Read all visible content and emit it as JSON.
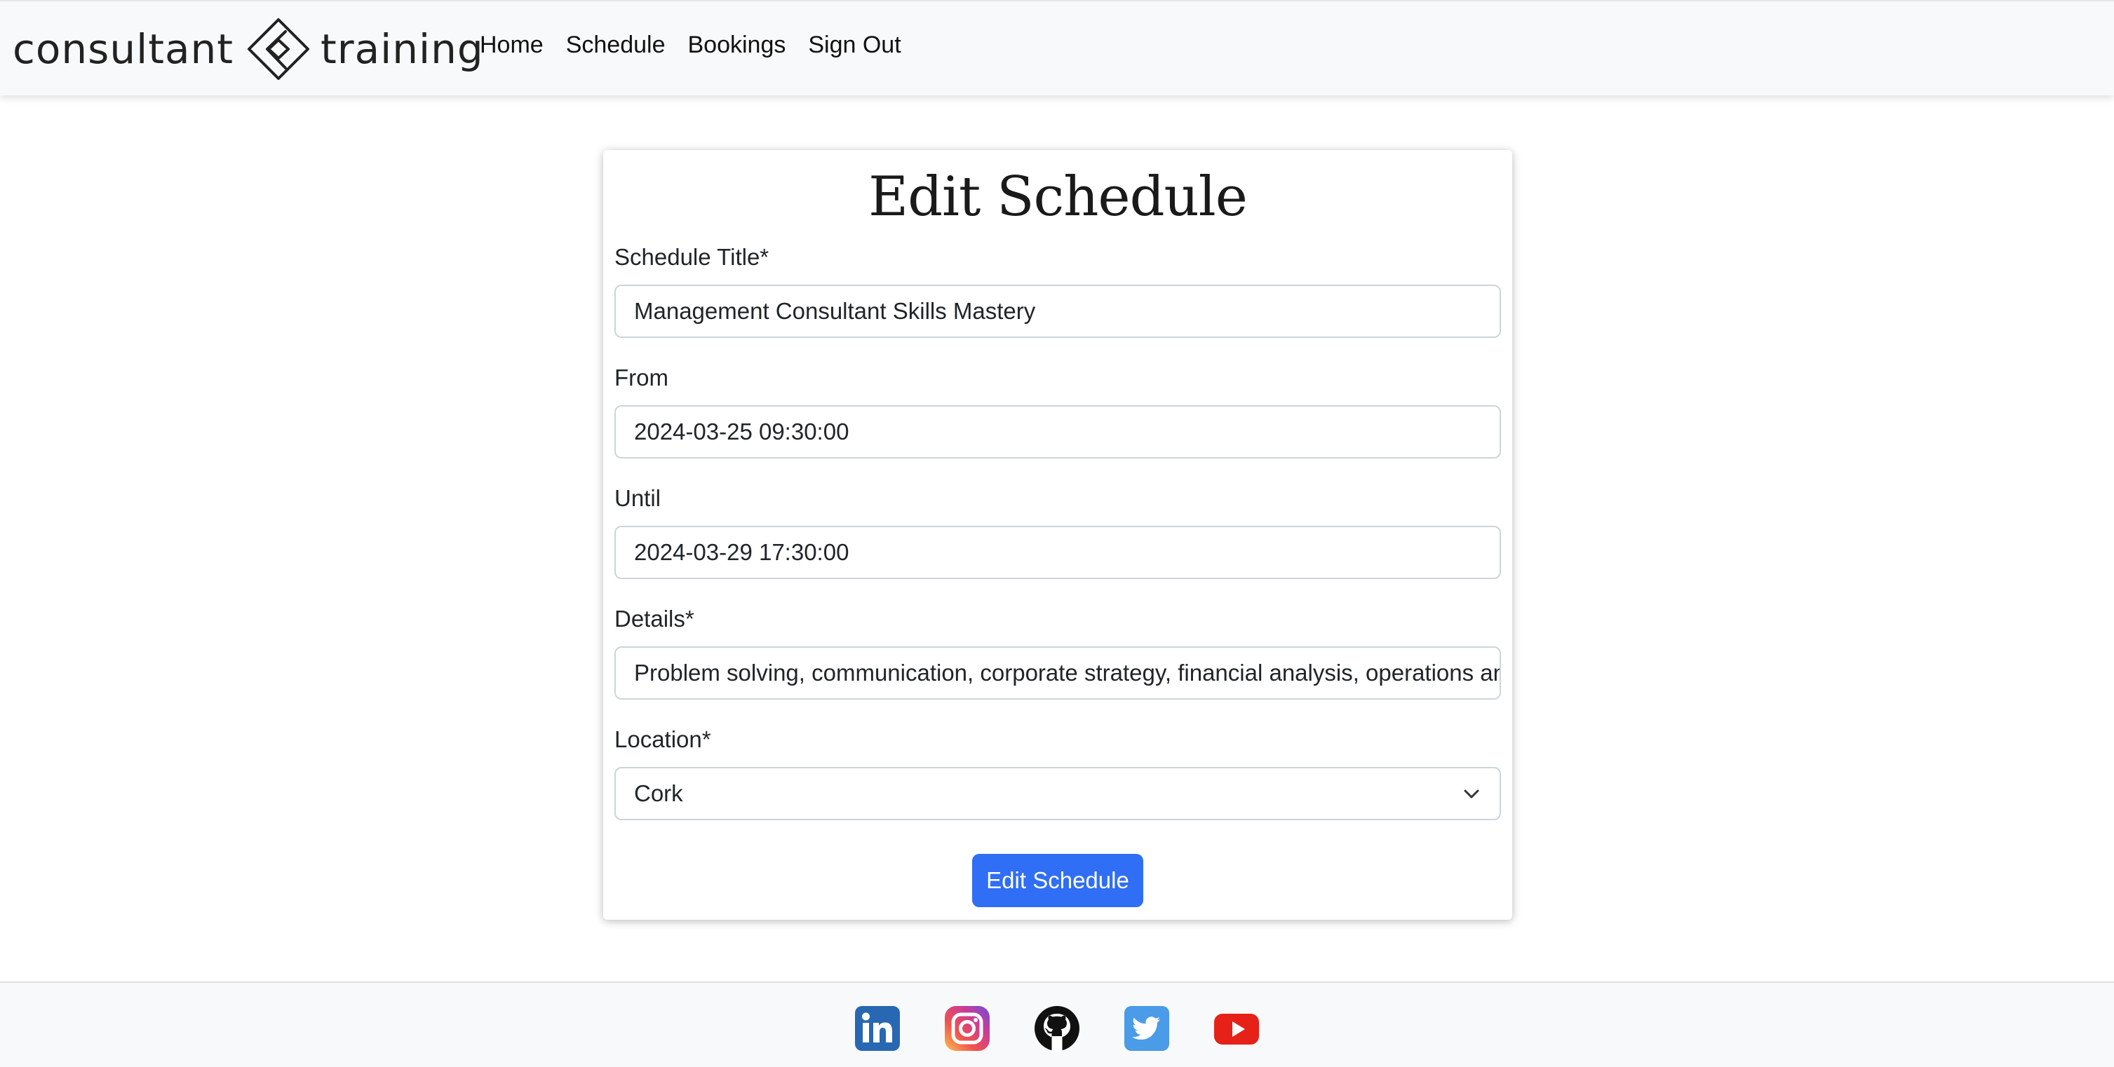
{
  "brand": {
    "left_word": "consultant",
    "right_word": "training",
    "logo": "diamond-logo"
  },
  "nav": {
    "items": [
      {
        "label": "Home"
      },
      {
        "label": "Schedule"
      },
      {
        "label": "Bookings"
      },
      {
        "label": "Sign Out"
      }
    ]
  },
  "form": {
    "title": "Edit Schedule",
    "fields": {
      "title": {
        "label": "Schedule Title*",
        "value": "Management Consultant Skills Mastery"
      },
      "from": {
        "label": "From",
        "value": "2024-03-25 09:30:00"
      },
      "until": {
        "label": "Until",
        "value": "2024-03-29 17:30:00"
      },
      "details": {
        "label": "Details*",
        "value": "Problem solving, communication, corporate strategy, financial analysis, operations analysis"
      },
      "location": {
        "label": "Location*",
        "value": "Cork",
        "icon": "chevron-down-icon"
      }
    },
    "submit_label": "Edit Schedule",
    "accent_color": "#2f6ef5"
  },
  "footer": {
    "icons": [
      "linkedin-icon",
      "instagram-icon",
      "github-icon",
      "twitter-icon",
      "youtube-icon"
    ],
    "colors": {
      "linkedin": "#2867b2",
      "twitter": "#4a9be8",
      "youtube": "#e62117",
      "github": "#111111"
    }
  }
}
